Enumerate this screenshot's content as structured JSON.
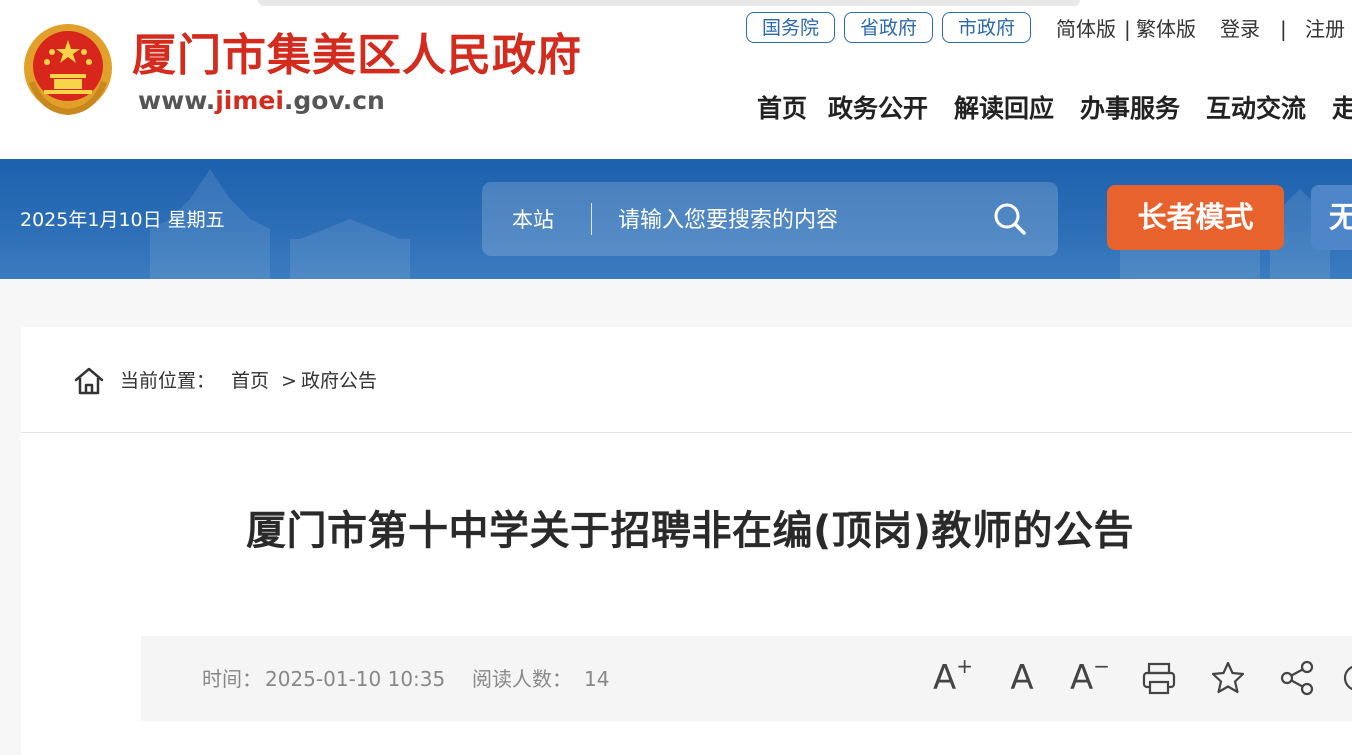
{
  "header": {
    "site_title": "厦门市集美区人民政府",
    "site_url_prefix": "www.",
    "site_url_accent": "jimei",
    "site_url_suffix": ".gov.cn",
    "top_links": {
      "state_council": "国务院",
      "province": "省政府",
      "city": "市政府",
      "lang_simplified": "简体版",
      "lang_sep": "|",
      "lang_traditional": "繁体版",
      "login": "登录",
      "login_sep": "|",
      "register": "注册"
    },
    "nav": [
      "首页",
      "政务公开",
      "解读回应",
      "办事服务",
      "互动交流",
      "走"
    ]
  },
  "banner": {
    "date": "2025年1月10日 星期五",
    "search_scope": "本站",
    "search_placeholder": "请输入您要搜索的内容",
    "elder_mode": "长者模式",
    "accessibility": "无"
  },
  "breadcrumb": {
    "label": "当前位置：",
    "home": "首页",
    "separator": ">",
    "current": "政府公告"
  },
  "article": {
    "title": "厦门市第十中学关于招聘非在编(顶岗)教师的公告",
    "time_label": "时间：",
    "time_value": "2025-01-10 10:35",
    "reads_label": "阅读人数：",
    "reads_value": "14"
  },
  "colors": {
    "brand_red": "#d32b1e",
    "banner_blue": "#1c61ae",
    "elder_orange": "#e8622e",
    "link_blue": "#2b69ae"
  },
  "icons": [
    "national-emblem",
    "search-icon",
    "home-icon",
    "font-increase-icon",
    "font-reset-icon",
    "font-decrease-icon",
    "print-icon",
    "star-icon",
    "share-icon"
  ]
}
